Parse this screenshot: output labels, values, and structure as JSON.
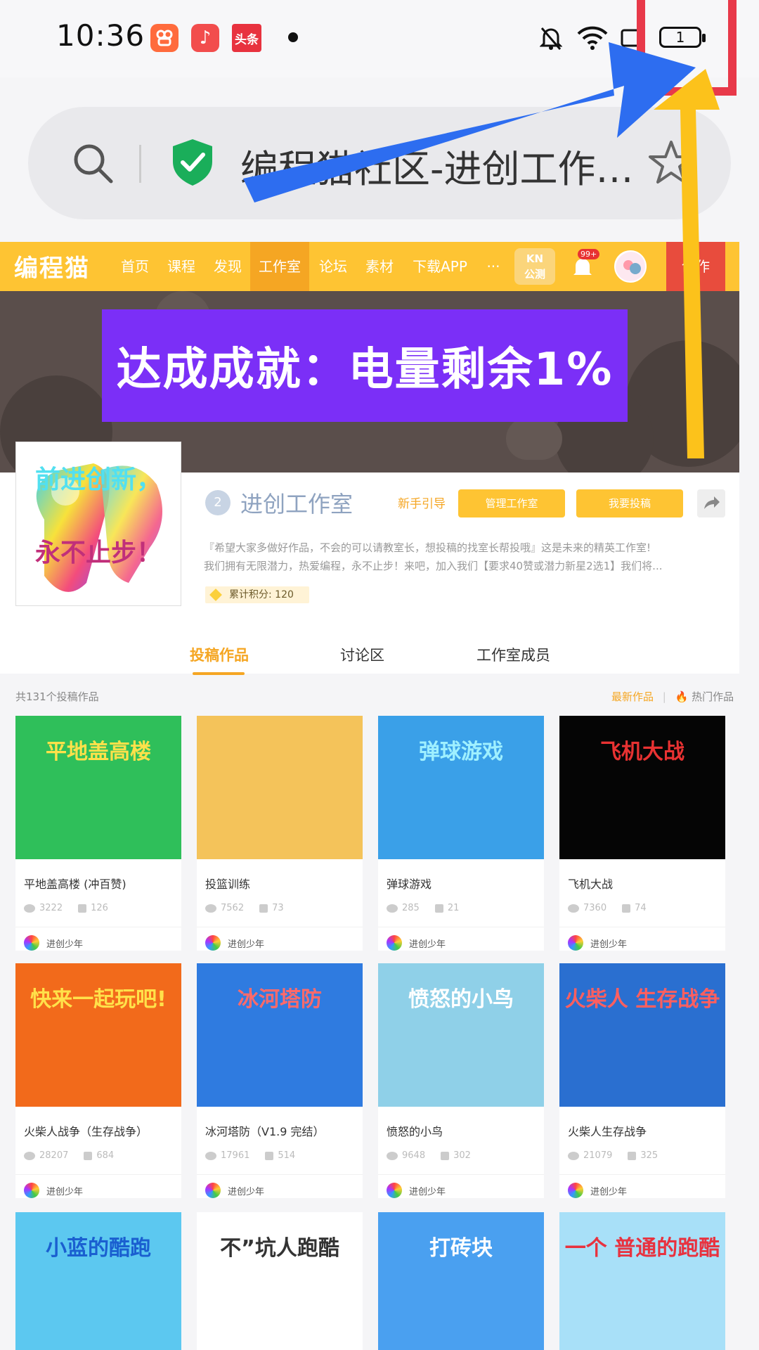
{
  "status_bar": {
    "time": "10:36",
    "apps": [
      {
        "name": "kuaishou-icon",
        "glyph": "ඞ",
        "color": "#ff6b3d"
      },
      {
        "name": "music-icon",
        "glyph": "♪",
        "color": "#f24d4d"
      },
      {
        "name": "toutiao-icon",
        "glyph": "头条",
        "color": "#e8323f"
      }
    ],
    "battery": "1"
  },
  "browser": {
    "url_title": "编程猫社区-进创工作…"
  },
  "site_nav": {
    "logo": "编程猫",
    "items": [
      "首页",
      "课程",
      "发现",
      "工作室",
      "论坛",
      "素材",
      "下载APP",
      "···"
    ],
    "active_index": 3,
    "kn_line1": "KN",
    "kn_line2": "公测",
    "notif_count": "99+",
    "create": "创作"
  },
  "banner": {
    "text": "达成成就：电量剩余1%"
  },
  "studio": {
    "logo_line1": "前进创新，",
    "logo_line2": "永不止步！",
    "level": "2",
    "name": "进创工作室",
    "guide": "新手引导",
    "manage_btn": "管理工作室",
    "submit_btn": "我要投稿",
    "desc_line1": "『希望大家多做好作品，不会的可以请教室长，想投稿的找室长帮投哦』这是未来的精英工作室!",
    "desc_line2": "我们拥有无限潜力，热爱编程，永不止步！来吧，加入我们【要求40赞或潜力新星2选1】我们将...",
    "points": "累计积分: 120"
  },
  "tabs": [
    "投稿作品",
    "讨论区",
    "工作室成员"
  ],
  "works": {
    "count_label": "共131个投稿作品",
    "sort_new": "最新作品",
    "sort_hot": "热门作品",
    "items": [
      {
        "title": "平地盖高楼 (冲百赞)",
        "views": "3222",
        "likes": "126",
        "author": "进创少年",
        "thumb_text": "平地盖高楼",
        "bg": "#2fbf5a",
        "fg": "#ffe14a"
      },
      {
        "title": "投篮训练",
        "views": "7562",
        "likes": "73",
        "author": "进创少年",
        "thumb_text": "",
        "bg": "#f4c35a",
        "fg": "#333"
      },
      {
        "title": "弹球游戏",
        "views": "285",
        "likes": "21",
        "author": "进创少年",
        "thumb_text": "弹球游戏",
        "bg": "#3aa0e8",
        "fg": "#9ff0ff"
      },
      {
        "title": "飞机大战",
        "views": "7360",
        "likes": "74",
        "author": "进创少年",
        "thumb_text": "飞机大战",
        "bg": "#050505",
        "fg": "#e83232"
      },
      {
        "title": "火柴人战争（生存战争）",
        "views": "28207",
        "likes": "684",
        "author": "进创少年",
        "thumb_text": "快来一起玩吧!",
        "bg": "#f26a1b",
        "fg": "#ffe14a"
      },
      {
        "title": "冰河塔防（V1.9 完结）",
        "views": "17961",
        "likes": "514",
        "author": "进创少年",
        "thumb_text": "冰河塔防",
        "bg": "#2f7be0",
        "fg": "#ff6a6a"
      },
      {
        "title": "愤怒的小鸟",
        "views": "9648",
        "likes": "302",
        "author": "进创少年",
        "thumb_text": "愤怒的小鸟",
        "bg": "#8fd0e8",
        "fg": "#fff"
      },
      {
        "title": "火柴人生存战争",
        "views": "21079",
        "likes": "325",
        "author": "进创少年",
        "thumb_text": "火柴人 生存战争",
        "bg": "#2a6fd0",
        "fg": "#ff5f5f"
      },
      {
        "title": "",
        "views": "",
        "likes": "",
        "author": "",
        "thumb_text": "小蓝的酷跑",
        "bg": "#5cc8f0",
        "fg": "#1a5fd0"
      },
      {
        "title": "",
        "views": "",
        "likes": "",
        "author": "",
        "thumb_text": "不”坑人跑酷",
        "bg": "#ffffff",
        "fg": "#333"
      },
      {
        "title": "",
        "views": "",
        "likes": "",
        "author": "",
        "thumb_text": "打砖块",
        "bg": "#4aa0f0",
        "fg": "#fff"
      },
      {
        "title": "",
        "views": "",
        "likes": "",
        "author": "",
        "thumb_text": "一个 普通的跑酷",
        "bg": "#a8e0f8",
        "fg": "#e8323f"
      }
    ]
  },
  "overlay": {
    "red_box_color": "#e8394a",
    "blue_arrow_color": "#2d6df0",
    "yellow_arrow_color": "#fcc21b"
  }
}
